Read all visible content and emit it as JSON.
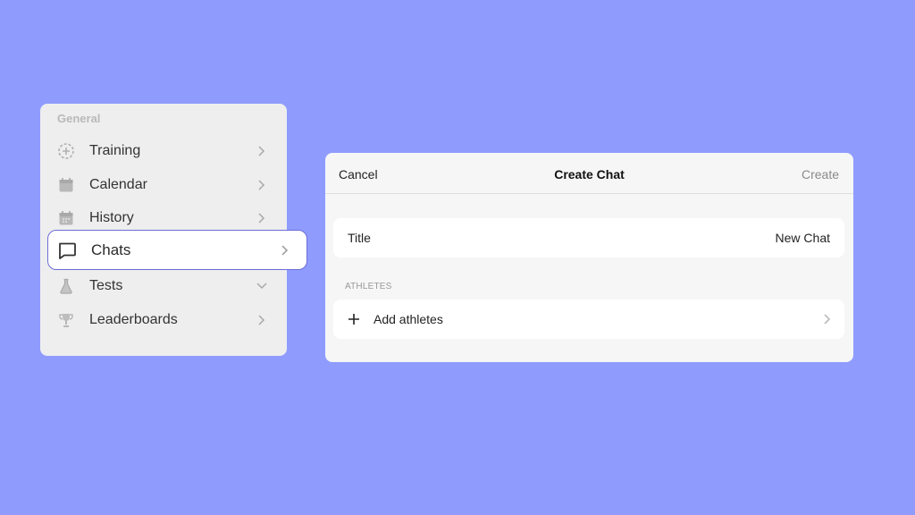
{
  "sidebar": {
    "section_title": "General",
    "items": [
      {
        "label": "Training",
        "icon": "training-icon",
        "chevron": "right"
      },
      {
        "label": "Calendar",
        "icon": "calendar-icon",
        "chevron": "right"
      },
      {
        "label": "History",
        "icon": "history-calendar-icon",
        "chevron": "right"
      },
      {
        "label": "Chats",
        "icon": "chat-bubble-icon",
        "chevron": "right"
      },
      {
        "label": "Tests",
        "icon": "flask-icon",
        "chevron": "down"
      },
      {
        "label": "Leaderboards",
        "icon": "trophy-icon",
        "chevron": "right"
      }
    ],
    "active_item": "Chats"
  },
  "dialog": {
    "cancel_label": "Cancel",
    "title": "Create Chat",
    "create_label": "Create",
    "title_field": {
      "label": "Title",
      "value": "New Chat"
    },
    "athletes_section": "ATHLETES",
    "add_athletes_label": "Add athletes"
  },
  "colors": {
    "background": "#8f9cfe",
    "active_border": "#6d6dd6",
    "panel": "#eeeeee",
    "dialog": "#f6f6f6"
  }
}
